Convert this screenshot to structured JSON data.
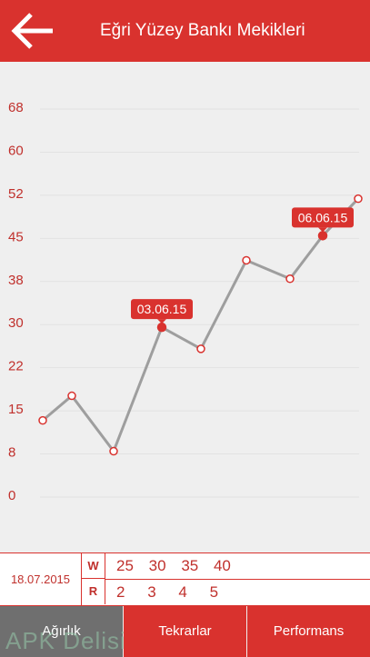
{
  "header": {
    "title": "Eğri Yüzey Bankı Mekikleri",
    "back_icon": "arrow-left-icon"
  },
  "chart_data": {
    "type": "line",
    "y_ticks": [
      "68",
      "60",
      "52",
      "45",
      "38",
      "30",
      "22",
      "15",
      "8",
      "0"
    ],
    "ylim": [
      0,
      68
    ],
    "values": [
      13,
      17,
      8,
      29,
      25,
      41,
      38,
      45,
      51
    ],
    "highlights": [
      {
        "index": 3,
        "label": "03.06.15"
      },
      {
        "index": 7,
        "label": "06.06.15"
      }
    ],
    "line_color": "#9e9e9e",
    "point_color": "#d9322e",
    "grid": true
  },
  "detail": {
    "date": "18.07.2015",
    "w_label": "W",
    "r_label": "R",
    "w_values": [
      "25",
      "30",
      "35",
      "40"
    ],
    "r_values": [
      "2",
      "3",
      "4",
      "5"
    ]
  },
  "tabs": [
    {
      "label": "Ağırlık",
      "active": true
    },
    {
      "label": "Tekrarlar"
    },
    {
      "label": "Performans"
    }
  ],
  "watermark": "APK Delisi",
  "colors": {
    "accent": "#d9322e",
    "inactive_tab": "#6f6f6f",
    "background": "#efefef"
  }
}
